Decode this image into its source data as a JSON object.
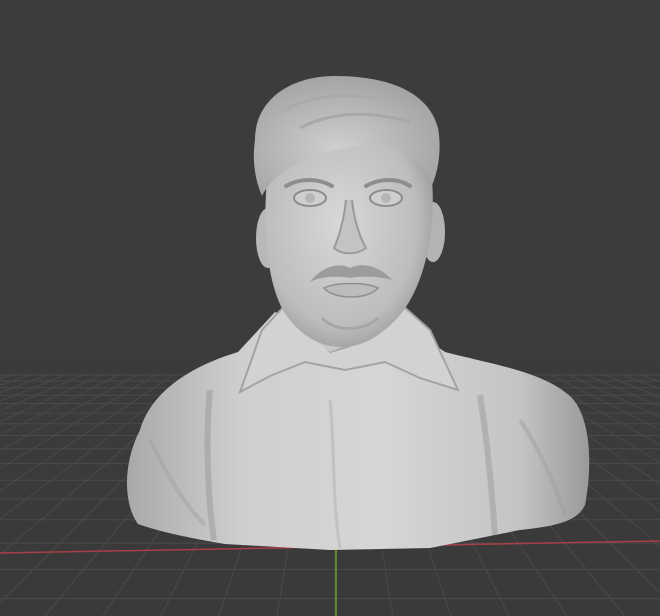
{
  "viewport": {
    "background": "#3c3c3c",
    "grid": {
      "visible": true,
      "line_color": "#4a4a4a",
      "x_axis_color": "#b33f48",
      "y_axis_color": "#6c9e2c"
    },
    "model": {
      "name": "bust",
      "material_color": "#cfcfcf",
      "shadow_color": "#8a8a8a"
    }
  }
}
